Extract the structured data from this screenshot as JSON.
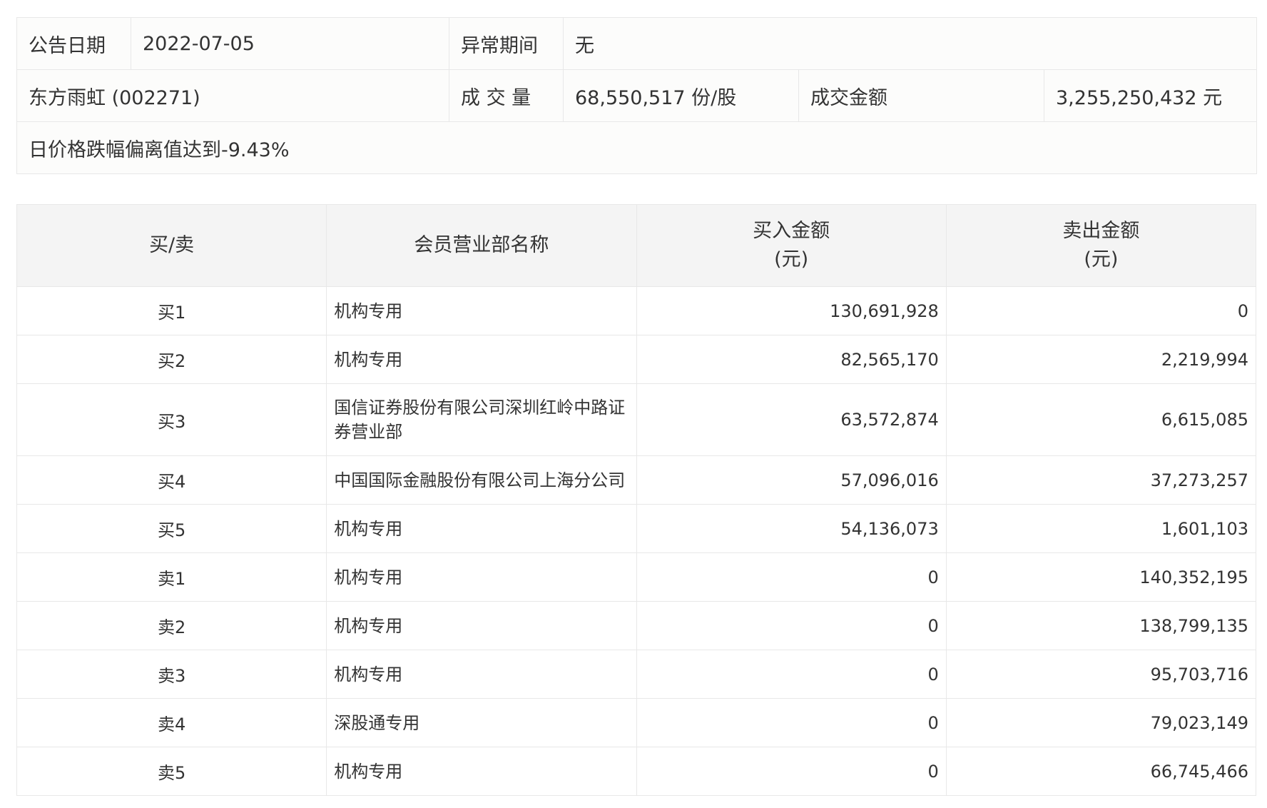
{
  "info": {
    "date_label": "公告日期",
    "date_value": "2022-07-05",
    "period_label": "异常期间",
    "period_value": "无",
    "stock": "东方雨虹 (002271)",
    "volume_label": "成 交 量",
    "volume_value": "68,550,517 份/股",
    "amount_label": "成交金额",
    "amount_value": "3,255,250,432 元",
    "description": "日价格跌幅偏离值达到-9.43%"
  },
  "table": {
    "headers": {
      "side": "买/卖",
      "name": "会员营业部名称",
      "buy_line1": "买入金额",
      "buy_line2": "(元)",
      "sell_line1": "卖出金额",
      "sell_line2": "(元)"
    },
    "rows": [
      {
        "side": "买1",
        "name": "机构专用",
        "buy": "130,691,928",
        "sell": "0"
      },
      {
        "side": "买2",
        "name": "机构专用",
        "buy": "82,565,170",
        "sell": "2,219,994"
      },
      {
        "side": "买3",
        "name": "国信证券股份有限公司深圳红岭中路证券营业部",
        "buy": "63,572,874",
        "sell": "6,615,085"
      },
      {
        "side": "买4",
        "name": "中国国际金融股份有限公司上海分公司",
        "buy": "57,096,016",
        "sell": "37,273,257"
      },
      {
        "side": "买5",
        "name": "机构专用",
        "buy": "54,136,073",
        "sell": "1,601,103"
      },
      {
        "side": "卖1",
        "name": "机构专用",
        "buy": "0",
        "sell": "140,352,195"
      },
      {
        "side": "卖2",
        "name": "机构专用",
        "buy": "0",
        "sell": "138,799,135"
      },
      {
        "side": "卖3",
        "name": "机构专用",
        "buy": "0",
        "sell": "95,703,716"
      },
      {
        "side": "卖4",
        "name": "深股通专用",
        "buy": "0",
        "sell": "79,023,149"
      },
      {
        "side": "卖5",
        "name": "机构专用",
        "buy": "0",
        "sell": "66,745,466"
      }
    ]
  }
}
